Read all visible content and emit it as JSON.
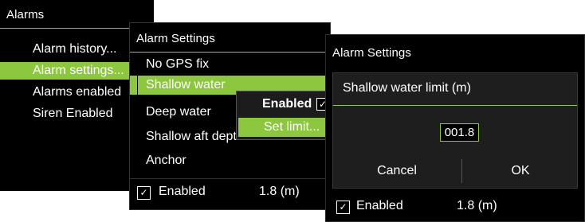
{
  "alarms_menu": {
    "title": "Alarms",
    "items": [
      "Alarm history...",
      "Alarm settings...",
      "Alarms enabled",
      "Siren Enabled"
    ],
    "selected_index": 1
  },
  "alarm_settings_menu": {
    "title": "Alarm Settings",
    "items": [
      "No GPS fix",
      "Shallow water",
      "Deep water",
      "Shallow aft depth",
      "Anchor"
    ],
    "selected_index": 1,
    "enabled_label": "Enabled",
    "enabled_checked": true,
    "value_text": "1.8 (m)"
  },
  "shallow_submenu": {
    "enabled_label": "Enabled",
    "enabled_checked": true,
    "set_limit_label": "Set limit..."
  },
  "limit_dialog": {
    "window_title": "Alarm Settings",
    "title": "Shallow water limit (m)",
    "value": "001.8",
    "cancel_label": "Cancel",
    "ok_label": "OK",
    "enabled_label": "Enabled",
    "enabled_checked": true,
    "value_text": "1.8 (m)"
  },
  "colors": {
    "accent": "#8dc63f",
    "background": "#000000",
    "dialog": "#1e1e1e",
    "text": "#ffffff"
  },
  "icons": {
    "checkbox": "check-icon"
  }
}
